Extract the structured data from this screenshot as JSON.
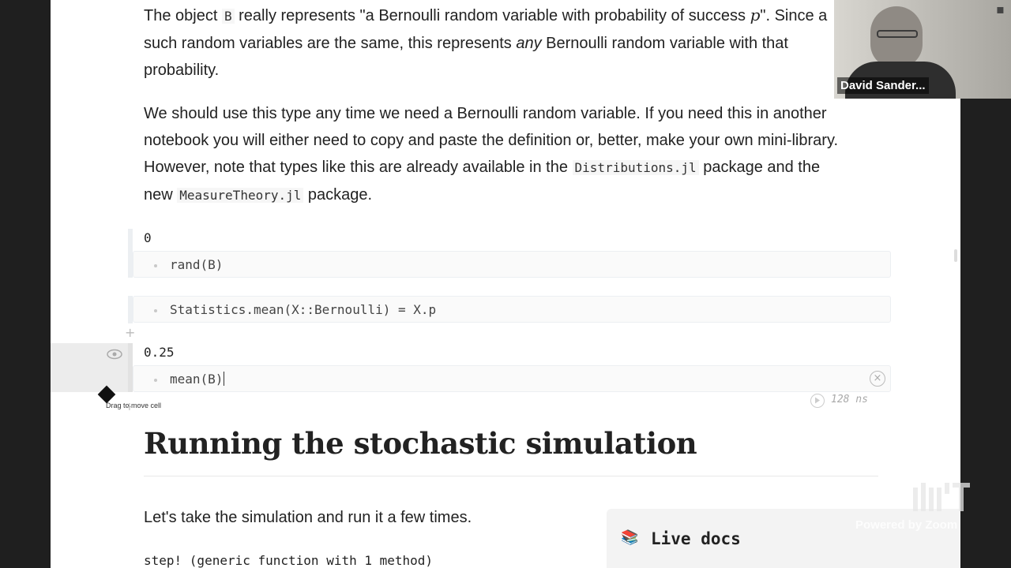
{
  "notebook": {
    "para1": {
      "t1": "The object ",
      "code1": "B",
      "t2": " really represents \"a Bernoulli random variable with probability of success ",
      "math": "p",
      "t3": "\". Since a",
      "line2a": "such random variables are the same, this represents ",
      "emph": "any",
      "line2b": " Bernoulli random variable with that",
      "line3": "probability."
    },
    "para2": {
      "line1": "We should use this type any time we need a Bernoulli random variable. If you need this in another",
      "line2": "notebook you will either need to copy and paste the definition or, better, make your own mini-library.",
      "line3a": "However, note that types like this are already available in the ",
      "code1": "Distributions.jl",
      "line3b": " package and the",
      "line4a": "new ",
      "code2": "MeasureTheory.jl",
      "line4b": " package."
    },
    "cells": [
      {
        "output": "0",
        "code": "rand(B)"
      },
      {
        "output": "",
        "code": "Statistics.mean(X::Bernoulli) = X.p"
      },
      {
        "output": "0.25",
        "code": "mean(B)"
      }
    ],
    "drag_tooltip": "Drag to move cell",
    "runtime": "128 ns",
    "heading": "Running the stochastic simulation",
    "para3": "Let's take the simulation and run it a few times.",
    "step_output": "step! (generic function with 1 method)"
  },
  "live_docs": {
    "icon": "books-icon",
    "label": "Live docs"
  },
  "video_overlay": {
    "participant_name": "David Sander...",
    "watermark": "Powered by Zoom",
    "logo_text": "MIT"
  }
}
